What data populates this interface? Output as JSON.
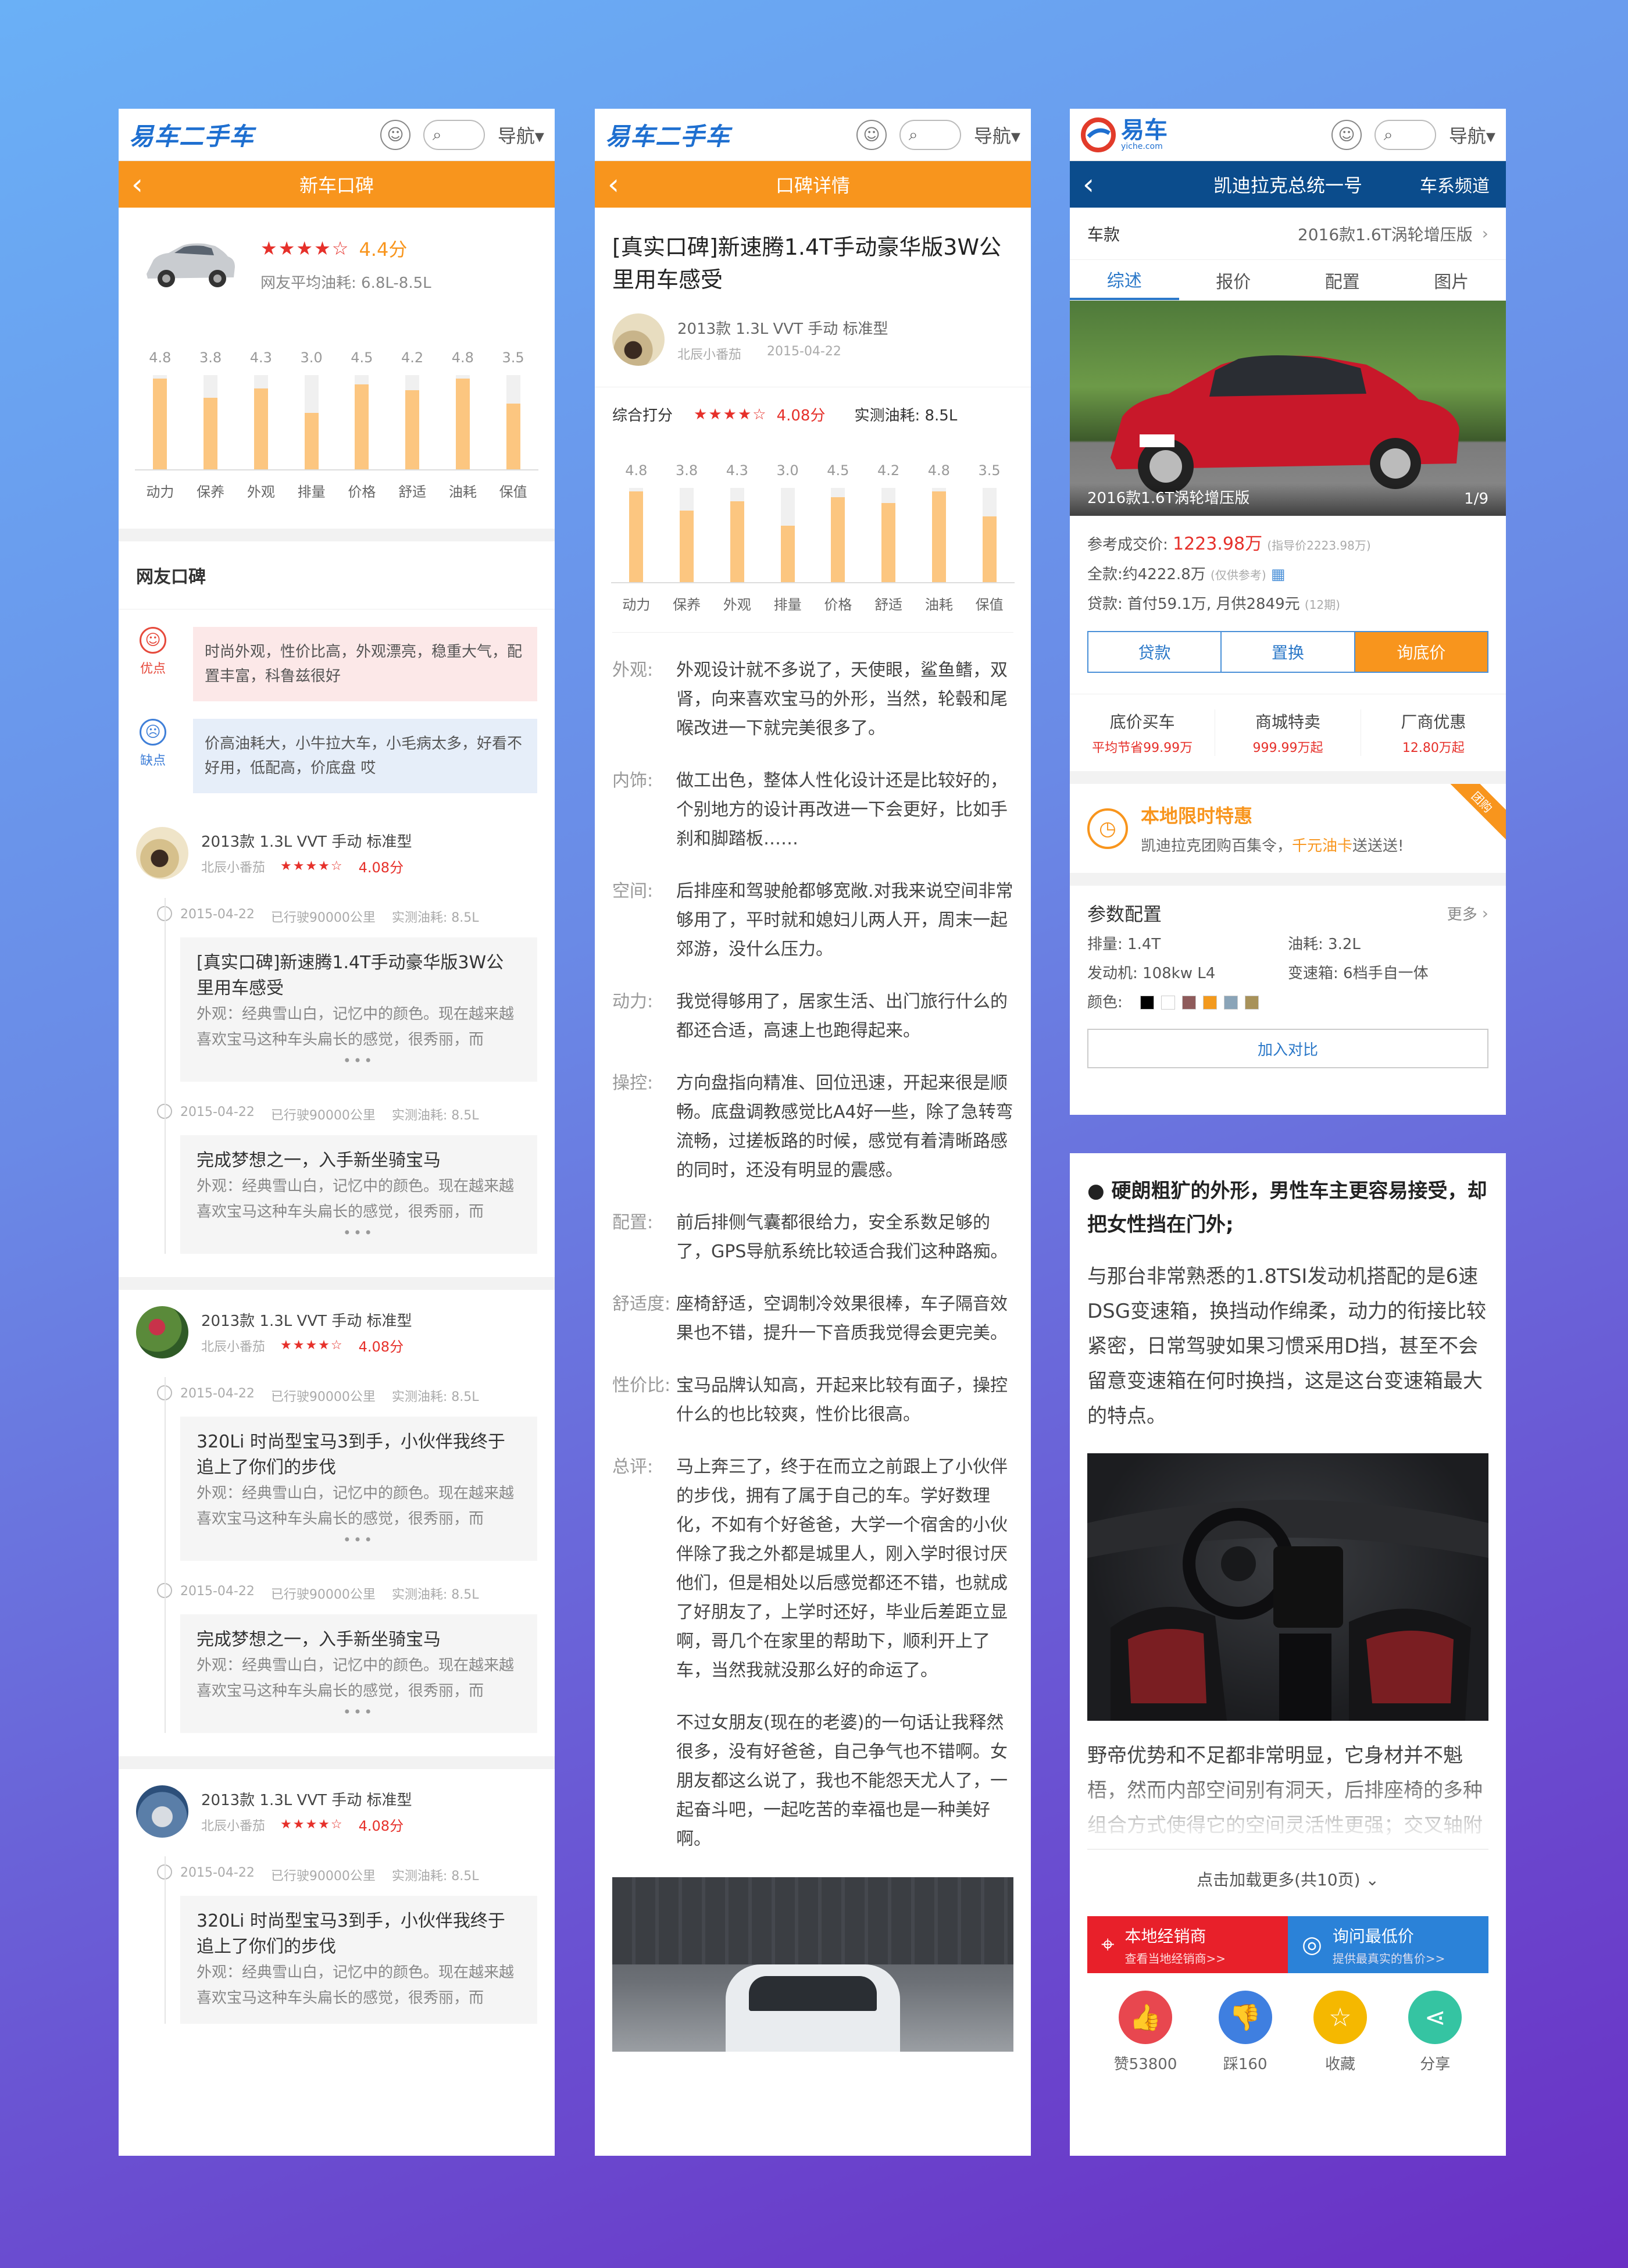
{
  "common": {
    "logo": "易车二手车",
    "nav": "导航▾",
    "user_icon": "user-icon",
    "search_icon": "search-icon"
  },
  "s1": {
    "title": "新车口碑",
    "rating_stars": "★★★★☆",
    "rating_score": "4.4分",
    "fuel": "网友平均油耗: 6.8L-8.5L",
    "scores": [
      {
        "label": "动力",
        "value": "4.8"
      },
      {
        "label": "保养",
        "value": "3.8"
      },
      {
        "label": "外观",
        "value": "4.3"
      },
      {
        "label": "排量",
        "value": "3.0"
      },
      {
        "label": "价格",
        "value": "4.5"
      },
      {
        "label": "舒适",
        "value": "4.2"
      },
      {
        "label": "油耗",
        "value": "4.8"
      },
      {
        "label": "保值",
        "value": "3.5"
      }
    ],
    "section_title": "网友口碑",
    "pros_label": "优点",
    "pros_text": "时尚外观，性价比高，外观漂亮，稳重大气，配置丰富，科鲁兹很好",
    "cons_label": "缺点",
    "cons_text": "价高油耗大，小牛拉大车，小毛病太多，好看不好用，低配高，价底盘 哎",
    "reviews": [
      {
        "model": "2013款 1.3L VVT 手动 标准型",
        "user": "北辰小番茄",
        "stars": "★★★★☆",
        "score": "4.08分",
        "entries": [
          {
            "date": "2015-04-22",
            "km": "已行驶90000公里",
            "fuel": "实测油耗: 8.5L",
            "title": "[真实口碑]新速腾1.4T手动豪华版3W公里用车感受",
            "body": "外观：经典雪山白，记忆中的颜色。现在越来越喜欢宝马这种车头扁长的感觉，很秀丽，而",
            "more": "•••"
          },
          {
            "date": "2015-04-22",
            "km": "已行驶90000公里",
            "fuel": "实测油耗: 8.5L",
            "title": "完成梦想之一，入手新坐骑宝马",
            "body": "外观：经典雪山白，记忆中的颜色。现在越来越喜欢宝马这种车头扁长的感觉，很秀丽，而",
            "more": "•••"
          }
        ]
      },
      {
        "model": "2013款 1.3L VVT 手动 标准型",
        "user": "北辰小番茄",
        "stars": "★★★★☆",
        "score": "4.08分",
        "entries": [
          {
            "date": "2015-04-22",
            "km": "已行驶90000公里",
            "fuel": "实测油耗: 8.5L",
            "title": "320Li 时尚型宝马3到手，小伙伴我终于追上了你们的步伐",
            "body": "外观：经典雪山白，记忆中的颜色。现在越来越喜欢宝马这种车头扁长的感觉，很秀丽，而",
            "more": "•••"
          },
          {
            "date": "2015-04-22",
            "km": "已行驶90000公里",
            "fuel": "实测油耗: 8.5L",
            "title": "完成梦想之一，入手新坐骑宝马",
            "body": "外观：经典雪山白，记忆中的颜色。现在越来越喜欢宝马这种车头扁长的感觉，很秀丽，而",
            "more": "•••"
          }
        ]
      },
      {
        "model": "2013款 1.3L VVT 手动 标准型",
        "user": "北辰小番茄",
        "stars": "★★★★☆",
        "score": "4.08分",
        "entries": [
          {
            "date": "2015-04-22",
            "km": "已行驶90000公里",
            "fuel": "实测油耗: 8.5L",
            "title": "320Li 时尚型宝马3到手，小伙伴我终于追上了你们的步伐",
            "body": "外观：经典雪山白，记忆中的颜色。现在越来越喜欢宝马这种车头扁长的感觉，很秀丽，而",
            "more": ""
          }
        ]
      }
    ]
  },
  "s2": {
    "title": "口碑详情",
    "headline": "[真实口碑]新速腾1.4T手动豪华版3W公里用车感受",
    "model": "2013款 1.3L VVT 手动 标准型",
    "user": "北辰小番茄",
    "date": "2015-04-22",
    "overall_label": "综合打分",
    "overall_stars": "★★★★☆",
    "overall_score": "4.08分",
    "fuel_label": "实测油耗: 8.5L",
    "sections": [
      {
        "label": "外观:",
        "text": "外观设计就不多说了，天使眼，鲨鱼鳍，双肾，向来喜欢宝马的外形，当然，轮毂和尾喉改进一下就完美很多了。"
      },
      {
        "label": "内饰:",
        "text": "做工出色，整体人性化设计还是比较好的，个别地方的设计再改进一下会更好，比如手刹和脚踏板……"
      },
      {
        "label": "空间:",
        "text": "后排座和驾驶舱都够宽敞.对我来说空间非常够用了，平时就和媳妇儿两人开，周末一起郊游，没什么压力。"
      },
      {
        "label": "动力:",
        "text": "我觉得够用了，居家生活、出门旅行什么的都还合适，高速上也跑得起来。"
      },
      {
        "label": "操控:",
        "text": "方向盘指向精准、回位迅速，开起来很是顺畅。底盘调教感觉比A4好一些，除了急转弯流畅，过搓板路的时候，感觉有着清晰路感的同时，还没有明显的震感。"
      },
      {
        "label": "配置:",
        "text": "前后排侧气囊都很给力，安全系数足够的了，GPS导航系统比较适合我们这种路痴。"
      },
      {
        "label": "舒适度:",
        "text": "座椅舒适，空调制冷效果很棒，车子隔音效果也不错，提升一下音质我觉得会更完美。"
      },
      {
        "label": "性价比:",
        "text": "宝马品牌认知高，开起来比较有面子，操控什么的也比较爽，性价比很高。"
      },
      {
        "label": "总评:",
        "text": "马上奔三了，终于在而立之前跟上了小伙伴的步伐，拥有了属于自己的车。学好数理化，不如有个好爸爸，大学一个宿舍的小伙伴除了我之外都是城里人，刚入学时很讨厌他们，但是相处以后感觉都还不错，也就成了好朋友了，上学时还好，毕业后差距立显啊，哥几个在家里的帮助下，顺利开上了车，当然我就没那么好的命运了。"
      },
      {
        "label": "",
        "text": "不过女朋友(现在的老婆)的一句话让我释然很多，没有好爸爸，自己争气也不错啊。女朋友都这么说了，我也不能怨天尤人了，一起奋斗吧，一起吃苦的幸福也是一种美好啊。"
      }
    ]
  },
  "s3": {
    "logo": "易车",
    "logo_sub": "yiche.com",
    "title": "凯迪拉克总统一号",
    "channel": "车系频道",
    "model_label": "车款",
    "model_value": "2016款1.6T涡轮增压版",
    "tabs": [
      "综述",
      "报价",
      "配置",
      "图片"
    ],
    "photo_caption": "2016款1.6T涡轮增压版",
    "photo_counter": "1/9",
    "price_label": "参考成交价:",
    "price_value": "1223.98万",
    "price_guide": "(指导价2223.98万)",
    "full_label": "全款:",
    "full_value": "约4222.8万",
    "full_note": "(仅供参考)",
    "loan_label": "贷款:",
    "loan_value": "首付59.1万, 月供2849元",
    "loan_note": "(12期)",
    "buttons": [
      "贷款",
      "置换",
      "询底价"
    ],
    "deals": [
      {
        "title": "底价买车",
        "sub": "平均节省99.99万"
      },
      {
        "title": "商城特卖",
        "sub": "999.99万起"
      },
      {
        "title": "厂商优惠",
        "sub": "12.80万起"
      }
    ],
    "promo_title": "本地限时特惠",
    "promo_text_a": "凯迪拉克团购百集令，",
    "promo_text_b": "千元油卡",
    "promo_text_c": "送送送!",
    "promo_badge": "团购",
    "params_title": "参数配置",
    "params_more": "更多",
    "params": [
      {
        "label": "排量:",
        "value": "1.4T"
      },
      {
        "label": "油耗:",
        "value": "3.2L"
      },
      {
        "label": "发动机:",
        "value": "108kw L4"
      },
      {
        "label": "变速箱:",
        "value": "6档手自一体"
      }
    ],
    "color_label": "颜色:",
    "colors": [
      "#000000",
      "#ffffff",
      "#8e5b5b",
      "#f39a1e",
      "#8aa4b8",
      "#a8925a"
    ],
    "compare": "加入对比"
  },
  "s4": {
    "heading": "● 硬朗粗犷的外形，男性车主更容易接受，却把女性挡在门外;",
    "para1": "与那台非常熟悉的1.8TSI发动机搭配的是6速DSG变速箱，换挡动作绵柔，动力的衔接比较紧密，日常驾驶如果习惯采用D挡，甚至不会留意变速箱在何时换挡，这是这台变速箱最大的特点。",
    "para2": "野帝优势和不足都非常明显，它身材并不魁梧，然而内部空间别有洞天，后排座椅的多种组合方式使得它的空间灵活性更强；交叉轴附困能力应该是在这观之上。",
    "load_more": "点击加载更多(共10页)",
    "dealer_title": "本地经销商",
    "dealer_sub": "查看当地经销商>>",
    "price_title": "询问最低价",
    "price_sub": "提供最真实的售价>>",
    "actions": [
      {
        "label": "赞53800",
        "icon": "thumbs-up-icon",
        "color": "#e8474f"
      },
      {
        "label": "踩160",
        "icon": "thumbs-down-icon",
        "color": "#3f7fe0"
      },
      {
        "label": "收藏",
        "icon": "star-icon",
        "color": "#f5b800"
      },
      {
        "label": "分享",
        "icon": "share-icon",
        "color": "#35c4a2"
      }
    ]
  }
}
